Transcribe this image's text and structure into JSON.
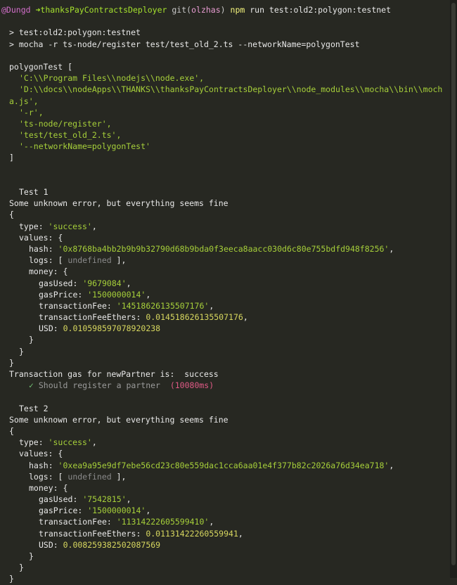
{
  "prompt": {
    "user": "@Dungd",
    "arrow": "➜",
    "dir": "thanksPayContractsDeployer",
    "git_label": "git",
    "branch_open": "(",
    "branch": "olzhas",
    "branch_close": ")",
    "npm": "npm",
    "command": "run test:old2:polygon:testnet"
  },
  "script_lines": [
    "> test:old2:polygon:testnet",
    "> mocha -r ts-node/register test/test_old_2.ts --networkName=polygonTest"
  ],
  "argv": {
    "header": "polygonTest [",
    "items": [
      "'C:\\\\Program Files\\\\nodejs\\\\node.exe',",
      "'D:\\\\docs\\\\nodeApps\\\\THANKS\\\\thanksPayContractsDeployer\\\\node_modules\\\\mocha\\\\bin\\\\moch",
      "a.js',",
      "'-r',",
      "'ts-node/register',",
      "'test/test_old_2.ts',",
      "'--networkName=polygonTest'"
    ],
    "footer": "]"
  },
  "tests": [
    {
      "title": "Test 1",
      "note": "Some unknown error, but everything seems fine",
      "type": "'success'",
      "hash": "'0x8768ba4bb2b9b9b32790d68b9bda0f3eeca8aacc030d6c80e755bdfd948f8256'",
      "logs": "undefined",
      "gasUsed": "'9679084'",
      "gasPrice": "'1500000014'",
      "transactionFee": "'14518626135507176'",
      "transactionFeeEthers": "0.014518626135507176",
      "USD": "0.010598597078920238",
      "result_line": "Transaction gas for newPartner is:  success",
      "check": "✓",
      "pass": "Should register a partner",
      "duration": "(10080ms)"
    },
    {
      "title": "Test 2",
      "note": "Some unknown error, but everything seems fine",
      "type": "'success'",
      "hash": "'0xea9a95e9df7ebe56cd23c80e559dac1cca6aa01e4f377b82c2026a76d34ea718'",
      "logs": "undefined",
      "gasUsed": "'7542815'",
      "gasPrice": "'1500000014'",
      "transactionFee": "'11314222605599410'",
      "transactionFeeEthers": "0.01131422260559941",
      "USD": "0.008259382502087569"
    }
  ],
  "labels": {
    "open_brace": "{",
    "close_brace": "}",
    "type_key": "type: ",
    "values_key": "values: {",
    "hash_key": "hash: ",
    "logs_key": "logs: [ ",
    "logs_close": " ],",
    "money_key": "money: {",
    "gasUsed_key": "gasUsed: ",
    "gasPrice_key": "gasPrice: ",
    "transactionFee_key": "transactionFee: ",
    "transactionFeeEthers_key": "transactionFeeEthers: ",
    "USD_key": "USD: ",
    "comma": ","
  },
  "colors": {
    "background": "#272822",
    "string": "#a6cf3a",
    "number": "#d7d75f",
    "pass_check": "#74c476",
    "duration": "#e05a86"
  }
}
